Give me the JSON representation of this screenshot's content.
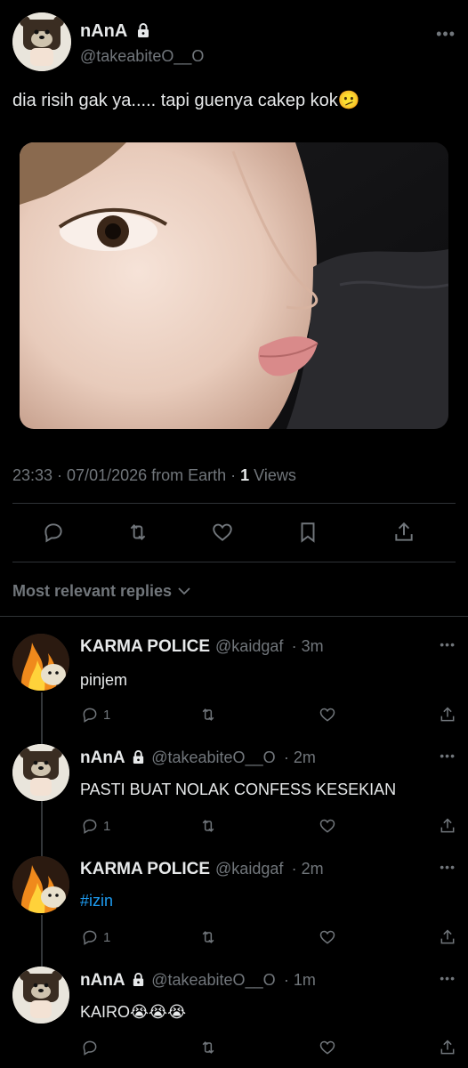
{
  "post": {
    "display_name": "nAnA",
    "handle": "@takeabiteO__O",
    "text": "dia risih gak ya..... tapi guenya cakep kok",
    "emoji": "🫤",
    "meta_time": "23:33 · 07/01/2026 from Earth · ",
    "views_count": "1",
    "views_label": " Views"
  },
  "replies_sort_label": "Most relevant replies",
  "replies": [
    {
      "display_name": "KARMA POLICE",
      "handle": "@kaidgaf",
      "time": "· 3m",
      "text": "pinjem",
      "reply_count": "1"
    },
    {
      "display_name": "nAnA",
      "handle": "@takeabiteO__O",
      "time": "· 2m",
      "text": "PASTI BUAT NOLAK CONFESS KESEKIAN",
      "reply_count": "1"
    },
    {
      "display_name": "KARMA POLICE",
      "handle": "@kaidgaf",
      "time": "· 2m",
      "text": "#izin",
      "reply_count": "1"
    },
    {
      "display_name": "nAnA",
      "handle": "@takeabiteO__O",
      "time": "· 1m",
      "text": "KAIRO😭😭😭",
      "reply_count": ""
    }
  ],
  "colors": {
    "background": "#000000",
    "text": "#e7e9ea",
    "muted": "#71767b",
    "accent": "#1d9bf0",
    "divider": "#2f3336"
  },
  "icons": [
    "lock-icon",
    "more-icon",
    "reply-icon",
    "retweet-icon",
    "like-icon",
    "bookmark-icon",
    "share-icon",
    "chevron-down-icon"
  ]
}
